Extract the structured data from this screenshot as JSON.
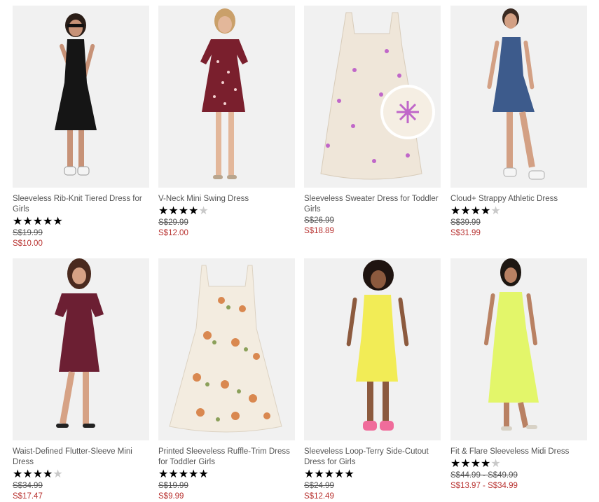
{
  "products": [
    {
      "title": "Sleeveless Rib-Knit Tiered Dress for Girls",
      "rating": 5,
      "rating_stars": "★★★★★",
      "rating_off": "",
      "price_original": "S$19.99",
      "price_sale": "S$10.00",
      "image": "girl-black-tiered-dress"
    },
    {
      "title": "V-Neck Mini Swing Dress",
      "rating": 4,
      "rating_stars": "★★★★",
      "rating_off": "★",
      "price_original": "S$29.99",
      "price_sale": "S$12.00",
      "image": "woman-red-floral-mini-dress"
    },
    {
      "title": "Sleeveless Sweater Dress for Toddler Girls",
      "rating": 0,
      "rating_stars": "",
      "rating_off": "",
      "price_original": "S$26.99",
      "price_sale": "S$18.89",
      "image": "cream-crochet-dress-with-pink-flowers"
    },
    {
      "title": "Cloud+ Strappy Athletic Dress",
      "rating": 4,
      "rating_stars": "★★★★",
      "rating_off": "★",
      "price_original": "S$39.99",
      "price_sale": "S$31.99",
      "image": "woman-blue-athletic-dress"
    },
    {
      "title": "Waist-Defined Flutter-Sleeve Mini Dress",
      "rating": 4,
      "rating_stars": "★★★★",
      "rating_off": "★",
      "price_original": "S$34.99",
      "price_sale": "S$17.47",
      "image": "woman-burgundy-flutter-dress"
    },
    {
      "title": "Printed Sleeveless Ruffle-Trim Dress for Toddler Girls",
      "rating": 5,
      "rating_stars": "★★★★★",
      "rating_off": "",
      "price_original": "S$19.99",
      "price_sale": "S$9.99",
      "image": "floral-print-toddler-dress"
    },
    {
      "title": "Sleeveless Loop-Terry Side-Cutout Dress for Girls",
      "rating": 5,
      "rating_stars": "★★★★★",
      "rating_off": "",
      "price_original": "S$24.99",
      "price_sale": "S$12.49",
      "image": "girl-yellow-terry-dress"
    },
    {
      "title": "Fit & Flare Sleeveless Midi Dress",
      "rating": 4,
      "rating_stars": "★★★★",
      "rating_off": "★",
      "price_original": "S$44.99 - S$49.99",
      "price_sale": "S$13.97 - S$34.99",
      "image": "woman-lime-midi-dress"
    }
  ],
  "colors": {
    "sale_price": "#b8312f",
    "star_on": "#000000",
    "star_off": "#c9c9c9",
    "image_bg": "#f2f2f2"
  }
}
